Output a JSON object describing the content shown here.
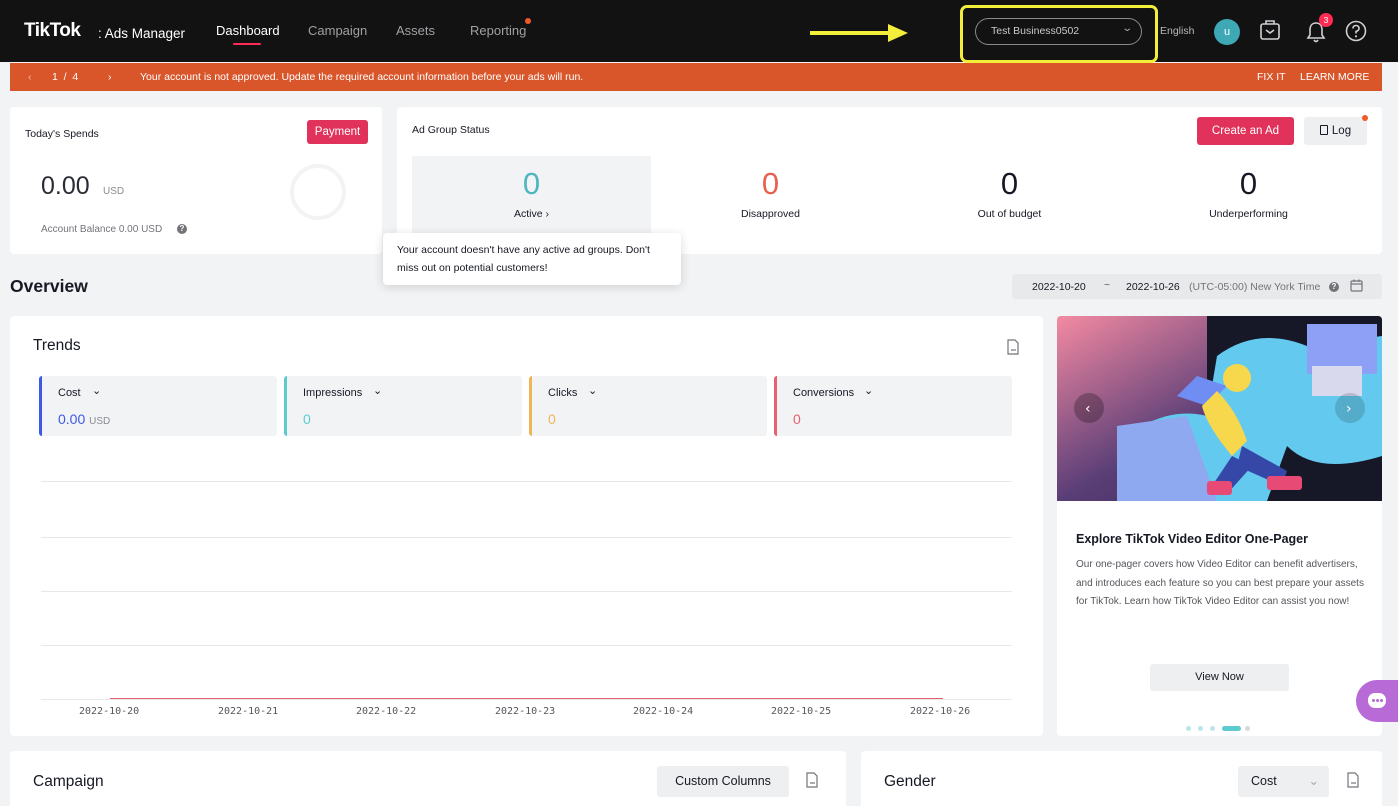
{
  "nav": {
    "logo": "TikTok",
    "logo_sub": ": Ads Manager",
    "tabs": [
      {
        "label": "Dashboard"
      },
      {
        "label": "Campaign"
      },
      {
        "label": "Assets"
      },
      {
        "label": "Reporting"
      }
    ],
    "business": "Test Business0502",
    "language": "English",
    "avatar_initial": "u",
    "notification_count": "3",
    "icons": [
      "briefcase-icon",
      "bell-icon",
      "help-icon"
    ]
  },
  "banner": {
    "pager": "1  /  4",
    "message": "Your account is not approved. Update the required account information before your ads will run.",
    "fix_it": "FIX IT",
    "learn_more": "LEARN MORE"
  },
  "spends": {
    "title": "Today's Spends",
    "payment_button": "Payment",
    "amount": "0.00",
    "currency": "USD",
    "balance": "Account Balance 0.00 USD"
  },
  "ad_group": {
    "title": "Ad Group Status",
    "create_button": "Create an Ad",
    "log_button": "Log",
    "stats": [
      {
        "value": "0",
        "label": "Active ›",
        "color": "#4fb6c0"
      },
      {
        "value": "0",
        "label": "Disapproved",
        "color": "#e8604f"
      },
      {
        "value": "0",
        "label": "Out of budget",
        "color": "#161823"
      },
      {
        "value": "0",
        "label": "Underperforming",
        "color": "#161823"
      }
    ],
    "tooltip": "Your account doesn't have any active ad groups. Don't miss out on potential customers!"
  },
  "overview": {
    "title": "Overview",
    "date_start": "2022-10-20",
    "date_sep": "~",
    "date_end": "2022-10-26",
    "timezone": "(UTC-05:00) New York Time"
  },
  "trends": {
    "title": "Trends",
    "metrics": [
      {
        "name": "Cost",
        "value": "0.00",
        "unit": "USD",
        "color": "#3c5ae6"
      },
      {
        "name": "Impressions",
        "value": "0",
        "unit": "",
        "color": "#5ccbd0"
      },
      {
        "name": "Clicks",
        "value": "0",
        "unit": "",
        "color": "#f1b45a"
      },
      {
        "name": "Conversions",
        "value": "0",
        "unit": "",
        "color": "#e8606f"
      }
    ],
    "x_labels": [
      "2022-10-20",
      "2022-10-21",
      "2022-10-22",
      "2022-10-23",
      "2022-10-24",
      "2022-10-25",
      "2022-10-26"
    ]
  },
  "promo": {
    "title": "Explore TikTok Video Editor One-Pager",
    "body": "Our one-pager covers how Video Editor can benefit advertisers, and introduces each feature so you can best prepare your assets for TikTok. Learn how TikTok Video Editor can assist you now!",
    "button": "View Now"
  },
  "campaign": {
    "title": "Campaign",
    "custom_columns": "Custom Columns"
  },
  "gender": {
    "title": "Gender",
    "select": "Cost"
  }
}
